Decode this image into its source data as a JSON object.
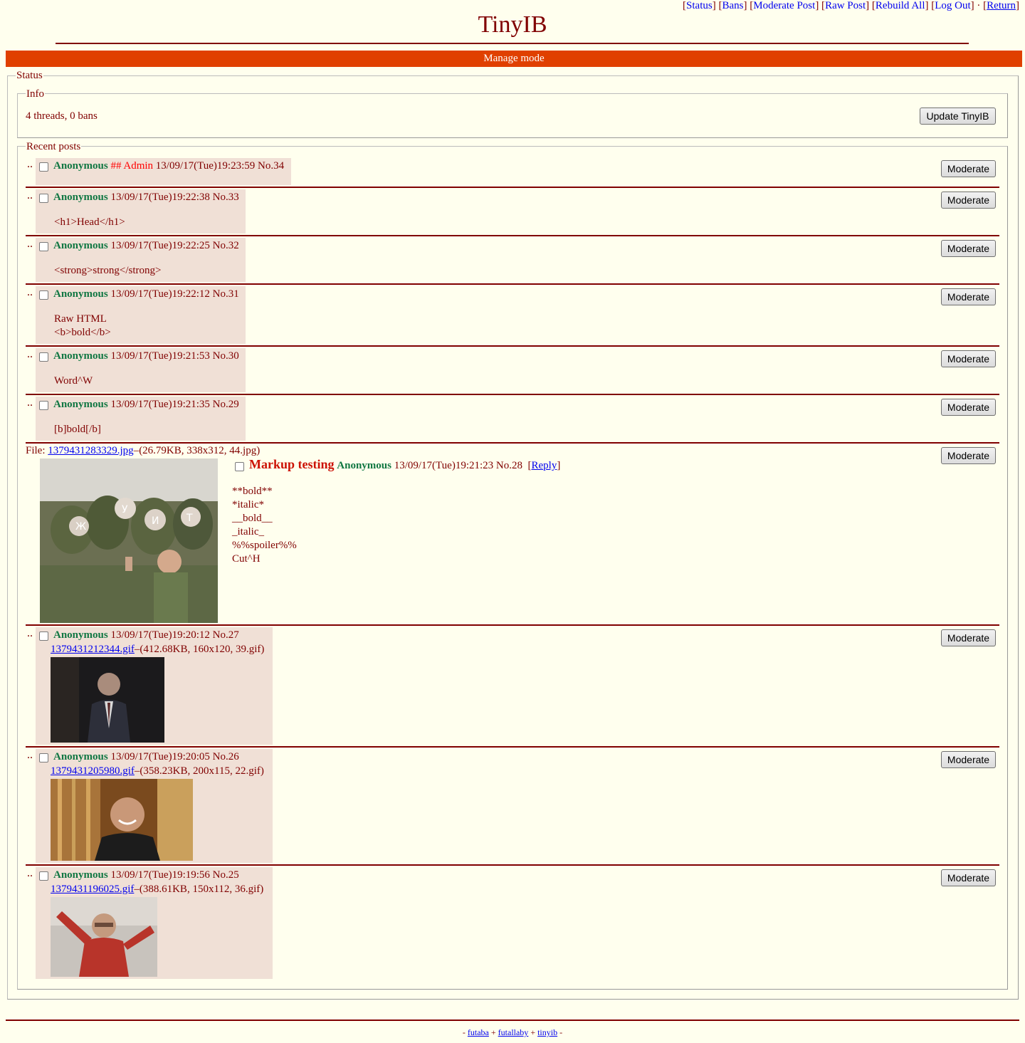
{
  "adminbar": {
    "links": [
      "Status",
      "Bans",
      "Moderate Post",
      "Raw Post",
      "Rebuild All",
      "Log Out"
    ],
    "return": "Return"
  },
  "logo": "TinyIB",
  "manage_bar": "Manage mode",
  "status": {
    "legend": "Status",
    "info": {
      "legend": "Info",
      "text": "4 threads, 0 bans",
      "update_button": "Update TinyIB"
    },
    "recent": {
      "legend": "Recent posts",
      "moderate_label": "Moderate",
      "posts": [
        {
          "name": "Anonymous",
          "admin": "## Admin",
          "date": "13/09/17(Tue)19:23:59",
          "no": "No.34"
        },
        {
          "name": "Anonymous",
          "date": "13/09/17(Tue)19:22:38",
          "no": "No.33",
          "message": "<h1>Head</h1>"
        },
        {
          "name": "Anonymous",
          "date": "13/09/17(Tue)19:22:25",
          "no": "No.32",
          "message": "<strong>strong</strong>"
        },
        {
          "name": "Anonymous",
          "date": "13/09/17(Tue)19:22:12",
          "no": "No.31",
          "message": "Raw HTML\n<b>bold</b>"
        },
        {
          "name": "Anonymous",
          "date": "13/09/17(Tue)19:21:53",
          "no": "No.30",
          "message": "Word^W"
        },
        {
          "name": "Anonymous",
          "date": "13/09/17(Tue)19:21:35",
          "no": "No.29",
          "message": "[b]bold[/b]"
        },
        {
          "op": true,
          "file_prefix": "File: ",
          "file": "1379431283329.jpg",
          "file_info": "–(26.79KB, 338x312, 44.jpg)",
          "subject": "Markup testing",
          "name": "Anonymous",
          "date": "13/09/17(Tue)19:21:23",
          "no": "No.28",
          "reply": "Reply",
          "message": "**bold**\n*italic*\n__bold__\n_italic_\n%%spoiler%%\nCut^H"
        },
        {
          "name": "Anonymous",
          "date": "13/09/17(Tue)19:20:12",
          "no": "No.27",
          "file": "1379431212344.gif",
          "file_info": "–(412.68KB, 160x120, 39.gif)"
        },
        {
          "name": "Anonymous",
          "date": "13/09/17(Tue)19:20:05",
          "no": "No.26",
          "file": "1379431205980.gif",
          "file_info": "–(358.23KB, 200x115, 22.gif)"
        },
        {
          "name": "Anonymous",
          "date": "13/09/17(Tue)19:19:56",
          "no": "No.25",
          "file": "1379431196025.gif",
          "file_info": "–(388.61KB, 150x112, 36.gif)"
        }
      ]
    }
  },
  "footer": {
    "links": [
      "futaba",
      "futallaby",
      "tinyib"
    ]
  }
}
